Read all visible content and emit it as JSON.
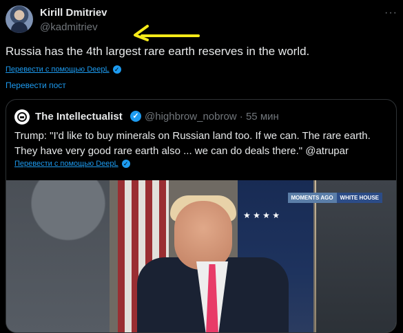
{
  "tweet": {
    "author_name": "Kirill Dmitriev",
    "author_handle": "@kadmitriev",
    "more_label": "···",
    "text": "Russia has the 4th largest rare earth reserves in the world.",
    "translate_link": "Перевести с помощью DeepL",
    "translate_post": "Перевести пост"
  },
  "quote": {
    "name": "The Intellectualist",
    "handle_time": "@highbrow_nobrow · 55 мин",
    "text": "Trump: \"I'd like to buy minerals on Russian land too. If we can. The rare earth. They have very good rare earth also ... we can do deals there.\" @atrupar",
    "translate_link": "Перевести с помощью DeepL"
  },
  "media": {
    "badge_left": "MOMENTS AGO",
    "badge_right": "WHITE HOUSE"
  },
  "colors": {
    "background": "#000000",
    "text": "#e7e9ea",
    "muted": "#71767b",
    "link": "#1d9bf0",
    "annotation": "#f6ea18"
  },
  "icons": {
    "verified": "verified-icon",
    "deepl": "deepl-icon",
    "more": "more-icon"
  }
}
